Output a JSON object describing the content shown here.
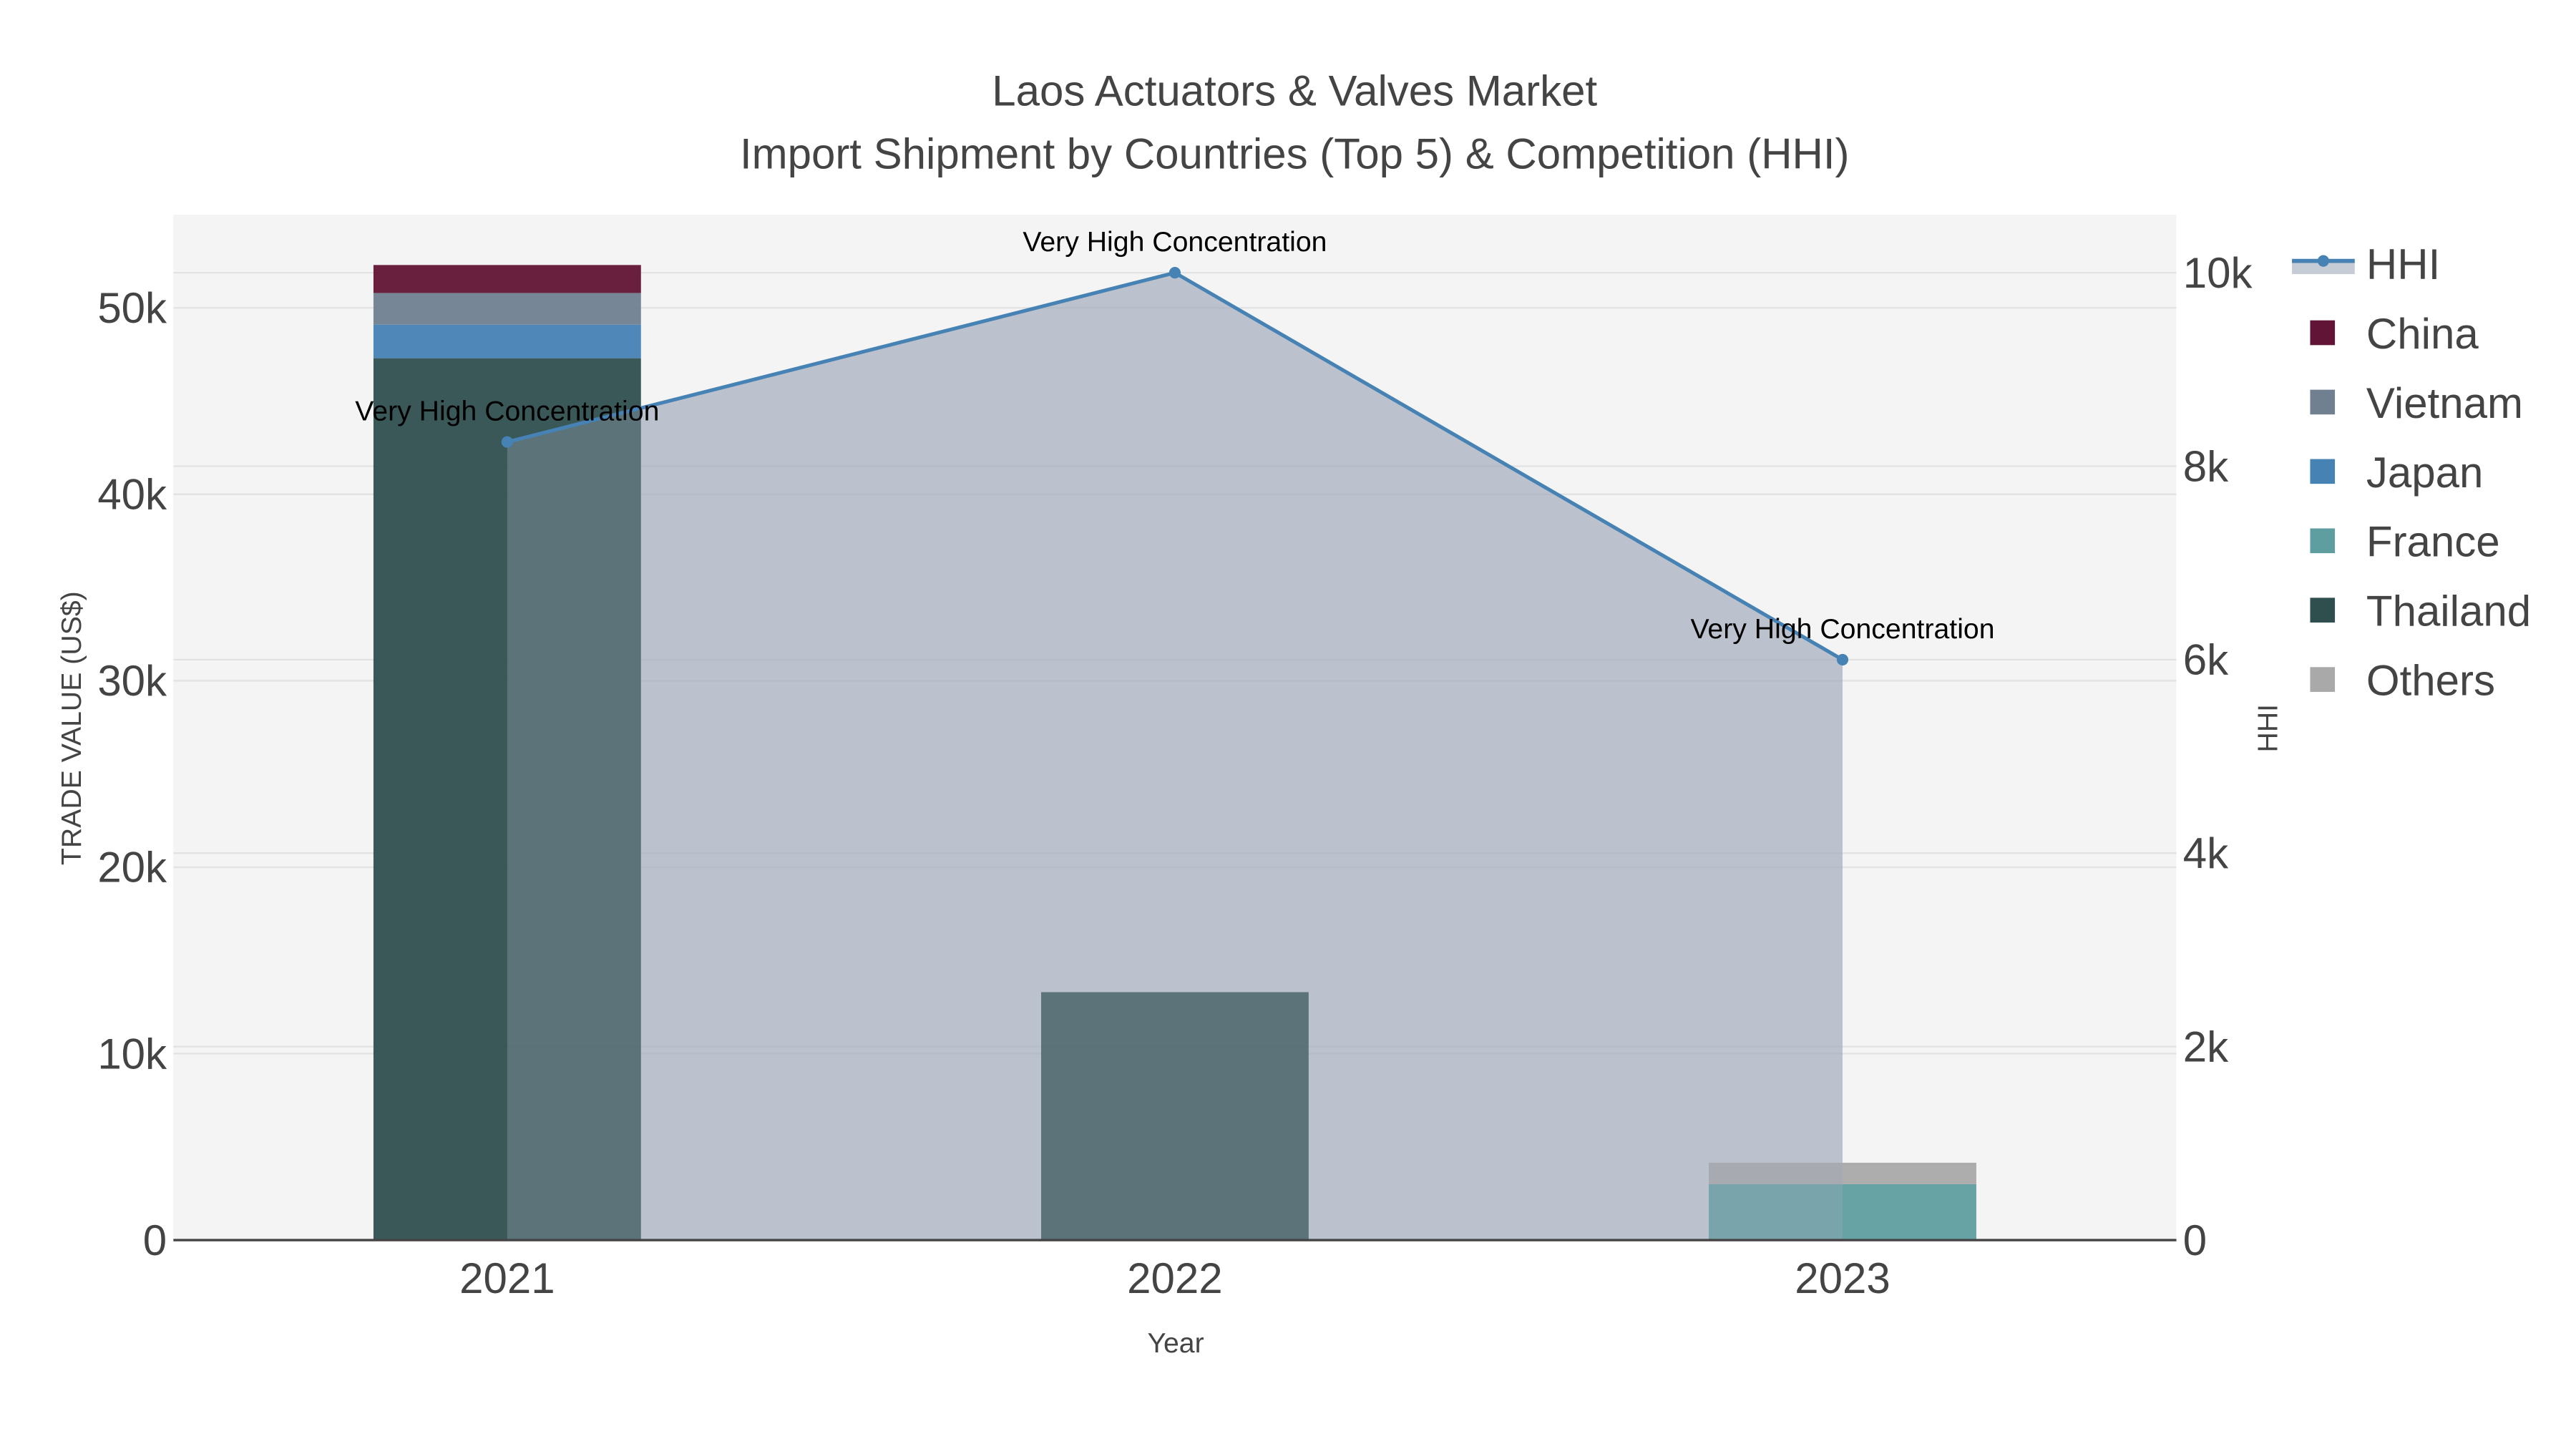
{
  "chart_data": {
    "type": "bar",
    "title": "Laos Actuators & Valves Market",
    "subtitle": "Import Shipment by Countries (Top 5) & Competition (HHI)",
    "xlabel": "Year",
    "ylabel": "TRADE VALUE (US$)",
    "y2label": "HHI",
    "categories": [
      "2021",
      "2022",
      "2023"
    ],
    "ylim": [
      0,
      55000
    ],
    "y2lim": [
      0,
      10600
    ],
    "yticks": [
      {
        "v": 0,
        "label": "0"
      },
      {
        "v": 10000,
        "label": "10k"
      },
      {
        "v": 20000,
        "label": "20k"
      },
      {
        "v": 30000,
        "label": "30k"
      },
      {
        "v": 40000,
        "label": "40k"
      },
      {
        "v": 50000,
        "label": "50k"
      }
    ],
    "y2ticks": [
      {
        "v": 0,
        "label": "0"
      },
      {
        "v": 2000,
        "label": "2k"
      },
      {
        "v": 4000,
        "label": "4k"
      },
      {
        "v": 6000,
        "label": "6k"
      },
      {
        "v": 8000,
        "label": "8k"
      },
      {
        "v": 10000,
        "label": "10k"
      }
    ],
    "stack_order": [
      "Thailand",
      "France",
      "Japan",
      "Vietnam",
      "China",
      "Others"
    ],
    "series": [
      {
        "name": "China",
        "color": "#611435",
        "values": [
          1500,
          0,
          0
        ]
      },
      {
        "name": "Vietnam",
        "color": "#708090",
        "values": [
          1700,
          0,
          0
        ]
      },
      {
        "name": "Japan",
        "color": "#4682B4",
        "values": [
          1800,
          0,
          0
        ]
      },
      {
        "name": "France",
        "color": "#5F9EA0",
        "values": [
          0,
          0,
          3000
        ]
      },
      {
        "name": "Thailand",
        "color": "#2F4F4F",
        "values": [
          47300,
          13300,
          0
        ]
      },
      {
        "name": "Others",
        "color": "#A9A9A9",
        "values": [
          0,
          0,
          1150
        ]
      }
    ],
    "hhi": {
      "name": "HHI",
      "color": "#4682B4",
      "values": [
        8250,
        10000,
        6000
      ],
      "annotations": [
        "Very High Concentration",
        "Very High Concentration",
        "Very High Concentration"
      ]
    },
    "grid": true,
    "legend": "right"
  }
}
